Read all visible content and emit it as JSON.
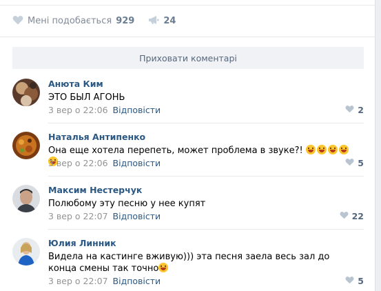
{
  "post": {
    "like_label": "Мені подобається",
    "like_count": "929",
    "share_count": "24"
  },
  "hide_comments_label": "Приховати коментарі",
  "comments": [
    {
      "author": "Анюта Ким",
      "text": "ЭТО БЫЛ АГОНЬ",
      "date": "3 вер о 22:06",
      "reply": "Відповісти",
      "likes": "2"
    },
    {
      "author": "Наталья Антипенко",
      "text": "Она еще хотела перепеть, может проблема в звуке?! ",
      "date": "3 вер о 22:06",
      "reply": "Відповісти",
      "likes": "5"
    },
    {
      "author": "Максим Нестерчук",
      "text": "Полюбому эту песню у нее купят",
      "date": "3 вер о 22:07",
      "reply": "Відповісти",
      "likes": "22"
    },
    {
      "author": "Юлия Линник",
      "text": "Видела на кастинге вживую))) эта песня заела весь зал до конца смены так точно",
      "date": "3 вер о 22:07",
      "reply": "Відповісти",
      "likes": "5"
    }
  ],
  "icons": {
    "like": "heart-icon",
    "share": "megaphone-icon",
    "emoji": "laughing-emoji-icon"
  },
  "colors": {
    "link": "#2a5885",
    "meta": "#939393",
    "icon": "#b9c4d1",
    "button_bg": "#f0f2f5"
  }
}
